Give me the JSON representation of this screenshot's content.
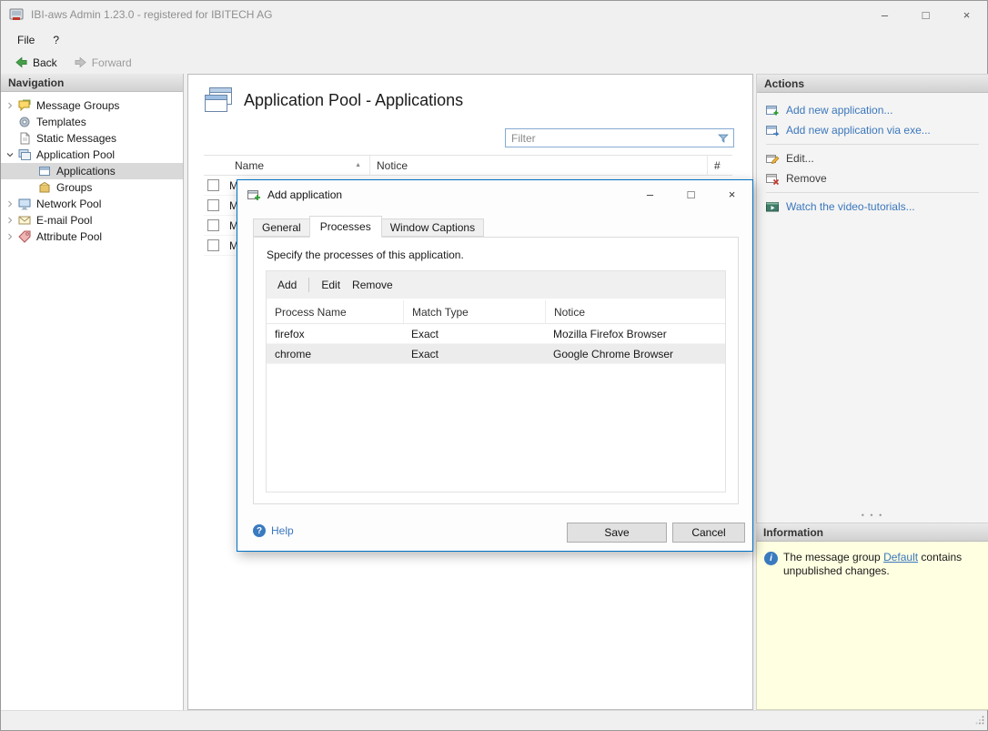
{
  "window": {
    "title": "IBI-aws Admin 1.23.0 - registered for IBITECH AG",
    "controls": {
      "minimize": "–",
      "maximize": "□",
      "close": "×"
    },
    "menu": {
      "file": "File",
      "help": "?"
    },
    "toolbar": {
      "back": "Back",
      "forward": "Forward"
    }
  },
  "navigation": {
    "header": "Navigation",
    "items": [
      {
        "label": "Message Groups"
      },
      {
        "label": "Templates"
      },
      {
        "label": "Static Messages"
      },
      {
        "label": "Application Pool"
      },
      {
        "label": "Applications"
      },
      {
        "label": "Groups"
      },
      {
        "label": "Network Pool"
      },
      {
        "label": "E-mail Pool"
      },
      {
        "label": "Attribute Pool"
      }
    ]
  },
  "main": {
    "title": "Application Pool - Applications",
    "filter_placeholder": "Filter",
    "columns": {
      "name": "Name",
      "notice": "Notice",
      "count": "#"
    },
    "rows": [
      {
        "name": "M"
      },
      {
        "name": "M"
      },
      {
        "name": "M"
      },
      {
        "name": "M"
      }
    ]
  },
  "actions": {
    "header": "Actions",
    "add_new": "Add new application...",
    "add_via_exe": "Add new application via exe...",
    "edit": "Edit...",
    "remove": "Remove",
    "watch": "Watch the video-tutorials..."
  },
  "information": {
    "header": "Information",
    "text_before": "The message group ",
    "link": "Default",
    "text_after": " contains unpublished changes."
  },
  "dialog": {
    "title": "Add application",
    "tabs": {
      "general": "General",
      "processes": "Processes",
      "window_captions": "Window Captions"
    },
    "description": "Specify the processes of this application.",
    "toolbar": {
      "add": "Add",
      "edit": "Edit",
      "remove": "Remove"
    },
    "columns": {
      "process": "Process Name",
      "match": "Match Type",
      "notice": "Notice"
    },
    "rows": [
      {
        "process": "firefox",
        "match": "Exact",
        "notice": "Mozilla Firefox Browser"
      },
      {
        "process": "chrome",
        "match": "Exact",
        "notice": "Google Chrome Browser"
      }
    ],
    "help": "Help",
    "save": "Save",
    "cancel": "Cancel"
  },
  "icons": {
    "sort_ascending": "▲",
    "help": "?",
    "info": "i",
    "splitter_dots": "• • •"
  },
  "colors": {
    "link": "#3b77bc",
    "dialog_border": "#0071c5",
    "info_bg": "#ffffe1",
    "selection": "#d9d9d9"
  }
}
